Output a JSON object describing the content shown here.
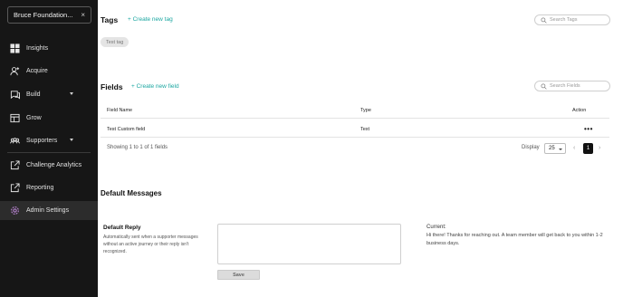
{
  "sidebar": {
    "org_name": "Bruce Foundation...",
    "org_close": "×",
    "items": [
      {
        "label": "Insights",
        "icon": "grid-icon"
      },
      {
        "label": "Acquire",
        "icon": "add-user-icon"
      },
      {
        "label": "Build",
        "icon": "chat-icon",
        "has_caret": true
      },
      {
        "label": "Grow",
        "icon": "board-icon"
      },
      {
        "label": "Supporters",
        "icon": "people-icon",
        "has_caret": true
      },
      {
        "label": "Challenge Analytics",
        "icon": "external-link-icon"
      },
      {
        "label": "Reporting",
        "icon": "external-link-icon"
      },
      {
        "label": "Admin Settings",
        "icon": "gear-icon",
        "active": true
      }
    ]
  },
  "tags": {
    "title": "Tags",
    "create_label": "+ Create new tag",
    "search_placeholder": "Search Tags",
    "chips": [
      "Test tag"
    ]
  },
  "fields": {
    "title": "Fields",
    "create_label": "+ Create new field",
    "search_placeholder": "Search Fields",
    "columns": [
      "Field Name",
      "Type",
      "Action"
    ],
    "rows": [
      {
        "name": "Test Custom field",
        "type": "Text",
        "action": "•••"
      }
    ],
    "showing": "Showing 1 to 1 of 1 fields",
    "display_label": "Display",
    "display_value": "25",
    "prev": "‹",
    "next": "›",
    "current_page": "1"
  },
  "default_messages": {
    "title": "Default Messages",
    "reply_title": "Default Reply",
    "reply_description": "Automatically sent when a supporter messages without an active journey or their reply isn't recognized.",
    "textarea_value": "",
    "save_label": "Save",
    "current_label": "Current:",
    "current_text": "Hi there! Thanks for reaching out. A team member will get back to you within 1-2 business days."
  },
  "colors": {
    "sidebar_bg": "#161616",
    "accent": "#1aa6a0",
    "active_item_bg": "#2c2c2c"
  }
}
